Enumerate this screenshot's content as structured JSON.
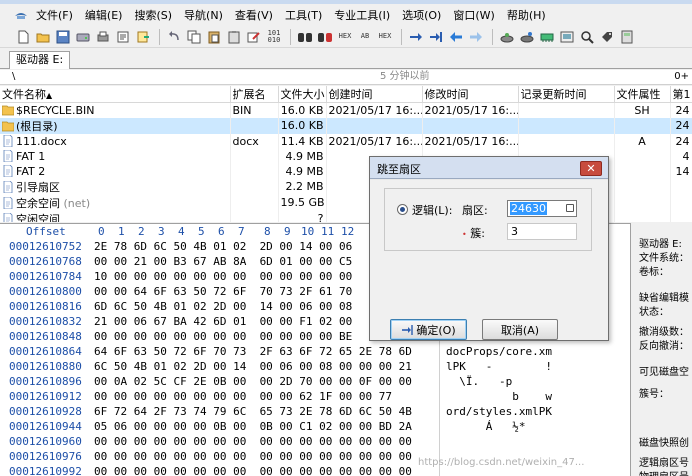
{
  "menu": {
    "items": [
      "文件(F)",
      "编辑(E)",
      "搜索(S)",
      "导航(N)",
      "查看(V)",
      "工具(T)",
      "专业工具(I)",
      "选项(O)",
      "窗口(W)",
      "帮助(H)"
    ]
  },
  "toolbar": {
    "icons": [
      "new-file-icon",
      "open-folder-icon",
      "save-icon",
      "open-disk-icon",
      "print-icon",
      "properties-icon",
      "export-icon",
      "undo-icon",
      "copy-icon",
      "paste-icon",
      "clipboard-icon",
      "write-icon",
      "binary-icon",
      "find-icon",
      "find-hex-icon",
      "find-text-icon",
      "replace-icon",
      "replace-hex-icon",
      "goto-offset-icon",
      "goto-sector-icon",
      "back-icon",
      "forward-icon",
      "disk-tools-icon",
      "disk-editor-icon",
      "ram-icon",
      "image-icon",
      "search-icon",
      "tag-icon",
      "calculator-icon"
    ],
    "labels": {
      "hex": "HEX",
      "hexab": "HEX",
      "ab": "AB",
      "binary": "101\n010"
    }
  },
  "tab": {
    "label": "驱动器 E:"
  },
  "pathbar": {
    "path": "\\",
    "status": "5 分钟以前",
    "count": "0+"
  },
  "file_list": {
    "headers": [
      "文件名称",
      "扩展名",
      "文件大小",
      "创建时间",
      "修改时间",
      "记录更新时间",
      "文件属性",
      "第1"
    ],
    "rows": [
      {
        "name": "$RECYCLE.BIN",
        "ext": "BIN",
        "size": "16.0 KB",
        "created": "2021/05/17  16:...",
        "modified": "2021/05/17  16:...",
        "attr": "SH",
        "first": "24",
        "icon": "folder-icon"
      },
      {
        "name": "(根目录)",
        "ext": "",
        "size": "16.0 KB",
        "created": "",
        "modified": "",
        "attr": "",
        "first": "24",
        "icon": "folder-icon"
      },
      {
        "name": "111.docx",
        "ext": "docx",
        "size": "11.4 KB",
        "created": "2021/05/17  16:...",
        "modified": "2021/05/17  16:...",
        "attr": "A",
        "first": "24",
        "icon": "file-icon"
      },
      {
        "name": "FAT 1",
        "ext": "",
        "size": "4.9 MB",
        "created": "",
        "modified": "",
        "attr": "",
        "first": "4",
        "icon": "file-icon"
      },
      {
        "name": "FAT 2",
        "ext": "",
        "size": "4.9 MB",
        "created": "",
        "modified": "",
        "attr": "",
        "first": "14",
        "icon": "file-icon"
      },
      {
        "name": "引导扇区",
        "ext": "",
        "size": "2.2 MB",
        "created": "",
        "modified": "",
        "attr": "",
        "first": "",
        "icon": "file-icon"
      },
      {
        "name": "空余空间",
        "net": "(net)",
        "ext": "",
        "size": "19.5 GB",
        "created": "",
        "modified": "",
        "attr": "",
        "first": "",
        "icon": "file-icon"
      },
      {
        "name": "空闲空间",
        "ext": "",
        "size": "?",
        "created": "",
        "modified": "",
        "attr": "",
        "first": "",
        "icon": "file-icon"
      }
    ]
  },
  "hex": {
    "offset_label": "Offset",
    "columns": [
      "0",
      "1",
      "2",
      "3",
      "4",
      "5",
      "6",
      "7",
      "8",
      "9",
      "10",
      "11",
      "12"
    ],
    "rows": [
      {
        "offset": "00012610752",
        "bytes": "2E 78 6D 6C 50 4B 01 02  2D 00 14 00 06",
        "ascii": ""
      },
      {
        "offset": "00012610768",
        "bytes": "00 00 21 00 B3 67 AB 8A  6D 01 00 00 C5",
        "ascii": ""
      },
      {
        "offset": "00012610784",
        "bytes": "10 00 00 00 00 00 00 00  00 00 00 00 00",
        "ascii": ""
      },
      {
        "offset": "00012610800",
        "bytes": "00 00 64 6F 63 50 72 6F  70 73 2F 61 70",
        "ascii": ""
      },
      {
        "offset": "00012610816",
        "bytes": "6D 6C 50 4B 01 02 2D 00  14 00 06 00 08",
        "ascii": ""
      },
      {
        "offset": "00012610832",
        "bytes": "21 00 06 67 BA 42 6D 01  00 00 F1 02 00",
        "ascii": ""
      },
      {
        "offset": "00012610848",
        "bytes": "00 00 00 00 00 00 00 00  00 00 00 00 BE",
        "ascii": ""
      },
      {
        "offset": "00012610864",
        "bytes": "64 6F 63 50 72 6F 70 73  2F 63 6F 72 65 2E 78 6D",
        "ascii": "docProps/core.xm"
      },
      {
        "offset": "00012610880",
        "bytes": "6C 50 4B 01 02 2D 00 14  00 06 00 08 00 00 00 21",
        "ascii": "lPK   -        !"
      },
      {
        "offset": "00012610896",
        "bytes": "00 0A 02 5C CF 2E 0B 00  00 2D 70 00 00 0F 00 00",
        "ascii": "  \\Ï.   -p     "
      },
      {
        "offset": "00012610912",
        "bytes": "00 00 00 00 00 00 00 00  00 00 62 1F 00 00 77",
        "ascii": "          b    w"
      },
      {
        "offset": "00012610928",
        "bytes": "6F 72 64 2F 73 74 79 6C  65 73 2E 78 6D 6C 50 4B",
        "ascii": "ord/styles.xmlPK"
      },
      {
        "offset": "00012610944",
        "bytes": "05 06 00 00 00 00 0B 00  0B 00 C1 02 00 00 BD 2A",
        "ascii": "      Á   ½*"
      },
      {
        "offset": "00012610960",
        "bytes": "00 00 00 00 00 00 00 00  00 00 00 00 00 00 00 00",
        "ascii": ""
      },
      {
        "offset": "00012610976",
        "bytes": "00 00 00 00 00 00 00 00  00 00 00 00 00 00 00 00",
        "ascii": ""
      },
      {
        "offset": "00012610992",
        "bytes": "00 00 00 00 00 00 00 00  00 00 00 00 00 00 00 00",
        "ascii": ""
      }
    ]
  },
  "right_panel": {
    "lines": [
      "驱动器 E:",
      "文件系统：",
      "卷标：",
      "缺省编辑模",
      "状态：",
      "撤消级数：",
      "反向撤消：",
      "可见磁盘空",
      "簇号：",
      "磁盘快照创",
      "逻辑扇区号",
      "物理扇区号"
    ]
  },
  "watermark": "https://blog.csdn.net/weixin_47...",
  "dialog": {
    "title": "跳至扇区",
    "radio_label": "逻辑(L):",
    "sector_label": "扇区:",
    "sector_value": "24630",
    "cluster_label": "簇:",
    "cluster_value": "3",
    "ok_label": "确定(O)",
    "cancel_label": "取消(A)"
  }
}
